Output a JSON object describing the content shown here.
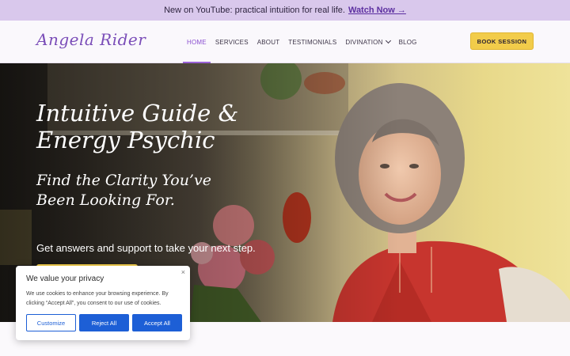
{
  "announcement": {
    "text": "New on YouTube: practical intuition for real life.",
    "link_label": "Watch Now →"
  },
  "nav": {
    "logo": "Angela Rider",
    "items": [
      {
        "label": "HOME",
        "active": true
      },
      {
        "label": "SERVICES"
      },
      {
        "label": "ABOUT"
      },
      {
        "label": "TESTIMONIALS"
      },
      {
        "label": "DIVINATION",
        "dropdown": true
      },
      {
        "label": "BLOG"
      }
    ],
    "cta": "BOOK SESSION"
  },
  "hero": {
    "title_line1": "Intuitive Guide &",
    "title_line2": "Energy Psychic",
    "subtitle_line1": "Find the Clarity You’ve",
    "subtitle_line2": "Been Looking For.",
    "tagline": "Get answers and support to take your next step."
  },
  "cookie": {
    "title": "We value your privacy",
    "text": "We use cookies to enhance your browsing experience. By clicking “Accept All”, you consent to our use of cookies.",
    "close": "×",
    "customize": "Customize",
    "reject": "Reject All",
    "accept": "Accept All"
  },
  "colors": {
    "announcement_bg": "#d9c8ec",
    "brand_purple": "#8a4fd0",
    "cta_yellow": "#f2cc4a",
    "cookie_blue": "#1d5fd6"
  }
}
